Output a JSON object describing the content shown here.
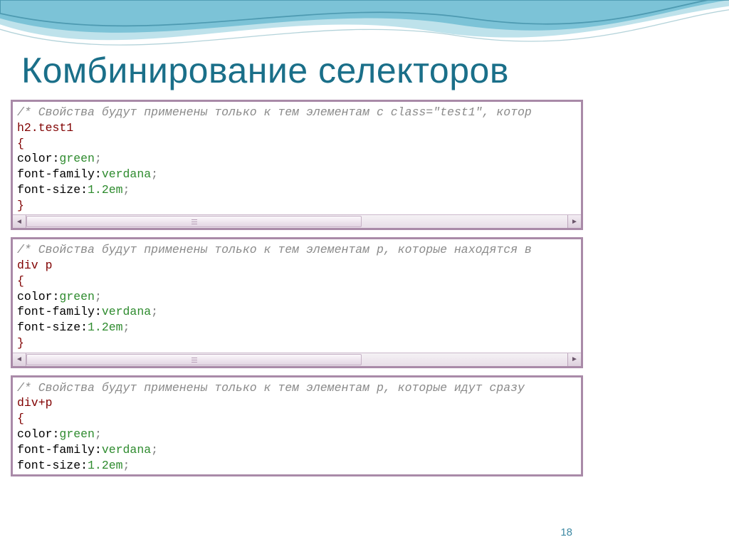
{
  "title": "Комбинирование селекторов",
  "page_number": "18",
  "blocks": [
    {
      "comment": "/* Свойства будут применены только к тем элементам с class=\"test1\", котор",
      "selector": "h2.test1",
      "rules": [
        {
          "prop": "color",
          "value": "green"
        },
        {
          "prop": "font-family",
          "value": "verdana"
        },
        {
          "prop": "font-size",
          "value": "1.2em"
        }
      ],
      "show_close_brace": true,
      "show_scrollbar": true
    },
    {
      "comment": "/* Свойства будут применены только к тем элементам p, которые находятся в",
      "selector": "div p",
      "rules": [
        {
          "prop": "color",
          "value": "green"
        },
        {
          "prop": "font-family",
          "value": "verdana"
        },
        {
          "prop": "font-size",
          "value": "1.2em"
        }
      ],
      "show_close_brace": true,
      "show_scrollbar": true
    },
    {
      "comment": "/* Свойства будут применены только к тем элементам p, которые идут сразу",
      "selector": "div+p",
      "rules": [
        {
          "prop": "color",
          "value": "green"
        },
        {
          "prop": "font-family",
          "value": "verdana"
        },
        {
          "prop": "font-size",
          "value": "1.2em"
        }
      ],
      "show_close_brace": false,
      "show_scrollbar": false
    }
  ]
}
